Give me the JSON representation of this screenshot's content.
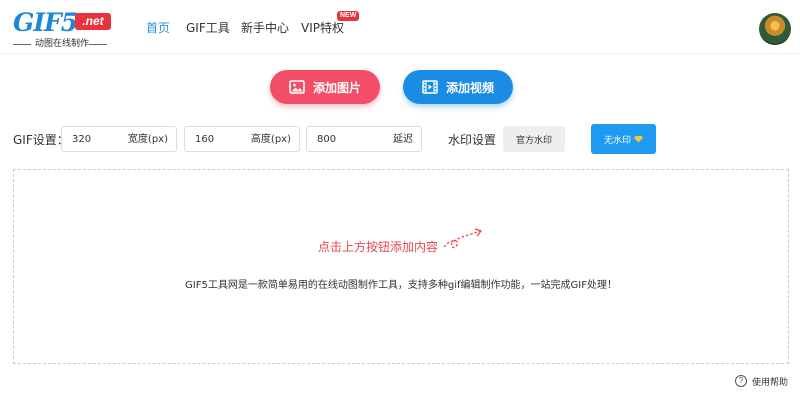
{
  "logo": {
    "main": "GIF5",
    "suffix": ".net",
    "tagline": "动图在线制作"
  },
  "nav": [
    {
      "label": "首页",
      "active": true
    },
    {
      "label": "GIF工具",
      "active": false
    },
    {
      "label": "新手中心",
      "active": false
    },
    {
      "label": "VIP特权",
      "active": false,
      "badge": "NEW"
    }
  ],
  "actions": {
    "add_image": "添加图片",
    "add_video": "添加视频"
  },
  "settings": {
    "label": "GIF设置：",
    "width": {
      "value": "320",
      "unit": "宽度(px)"
    },
    "height": {
      "value": "160",
      "unit": "高度(px)"
    },
    "delay": {
      "value": "800",
      "unit": "延迟"
    },
    "watermark_label": "水印设置",
    "watermark_official": "官方水印",
    "watermark_none": "无水印"
  },
  "dropzone": {
    "hint": "点击上方按钮添加内容",
    "description": "GIF5工具网是一款简单易用的在线动图制作工具，支持多种gif编辑制作功能，一站完成GIF处理！"
  },
  "help": {
    "label": "使用帮助",
    "icon": "question-icon"
  },
  "colors": {
    "primary_blue": "#1b8ce3",
    "accent_red": "#f34d67",
    "hint_red": "#e8474f"
  }
}
